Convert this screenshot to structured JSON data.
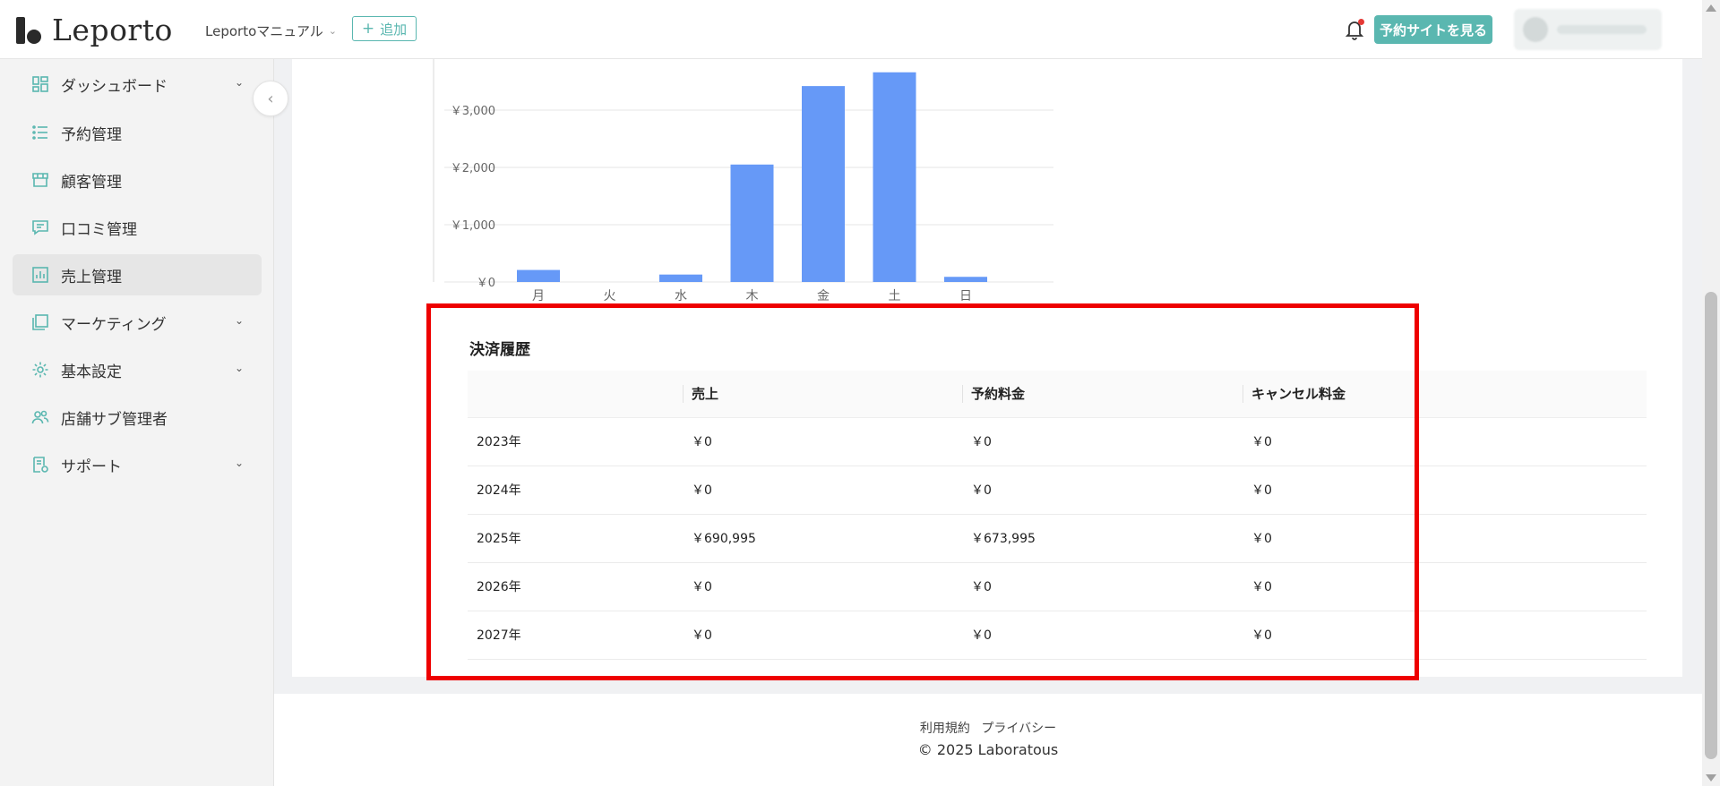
{
  "header": {
    "logo_text": "Leporto",
    "store_name": "Leportoマニュアル",
    "add_label": "追加",
    "view_site_label": "予約サイトを見る"
  },
  "sidebar": {
    "items": [
      {
        "label": "ダッシュボード",
        "icon": "dashboard-icon",
        "has_arrow": true
      },
      {
        "label": "予約管理",
        "icon": "list-icon",
        "has_arrow": false
      },
      {
        "label": "顧客管理",
        "icon": "store-icon",
        "has_arrow": false
      },
      {
        "label": "口コミ管理",
        "icon": "comment-icon",
        "has_arrow": false
      },
      {
        "label": "売上管理",
        "icon": "bar-chart-icon",
        "has_arrow": false,
        "active": true
      },
      {
        "label": "マーケティング",
        "icon": "layers-icon",
        "has_arrow": true
      },
      {
        "label": "基本設定",
        "icon": "gear-icon",
        "has_arrow": true
      },
      {
        "label": "店舗サブ管理者",
        "icon": "users-icon",
        "has_arrow": false
      },
      {
        "label": "サポート",
        "icon": "support-doc-icon",
        "has_arrow": true
      }
    ]
  },
  "chart_data": {
    "type": "bar",
    "categories": [
      "月",
      "火",
      "水",
      "木",
      "金",
      "土",
      "日"
    ],
    "values": [
      210,
      0,
      130,
      2050,
      3420,
      3660,
      90
    ],
    "ylim": [
      0,
      3700
    ],
    "yticks": [
      0,
      1000,
      2000,
      3000
    ],
    "ytick_labels": [
      "￥0",
      "￥1,000",
      "￥2,000",
      "￥3,000"
    ],
    "grid": true,
    "bar_color": "#6699f7"
  },
  "payment_history": {
    "title": "決済履歴",
    "columns": [
      "",
      "売上",
      "予約料金",
      "キャンセル料金"
    ],
    "rows": [
      {
        "year": "2023年",
        "sales": "￥0",
        "booking_fee": "￥0",
        "cancel_fee": "￥0"
      },
      {
        "year": "2024年",
        "sales": "￥0",
        "booking_fee": "￥0",
        "cancel_fee": "￥0"
      },
      {
        "year": "2025年",
        "sales": "￥690,995",
        "booking_fee": "￥673,995",
        "cancel_fee": "￥0"
      },
      {
        "year": "2026年",
        "sales": "￥0",
        "booking_fee": "￥0",
        "cancel_fee": "￥0"
      },
      {
        "year": "2027年",
        "sales": "￥0",
        "booking_fee": "￥0",
        "cancel_fee": "￥0"
      }
    ]
  },
  "footer": {
    "terms_label": "利用規約",
    "privacy_label": "プライバシー",
    "copyright": "2025 Laboratous"
  },
  "colors": {
    "accent": "#5ab7b0",
    "highlight": "#ee0000",
    "notification": "#e53935"
  }
}
